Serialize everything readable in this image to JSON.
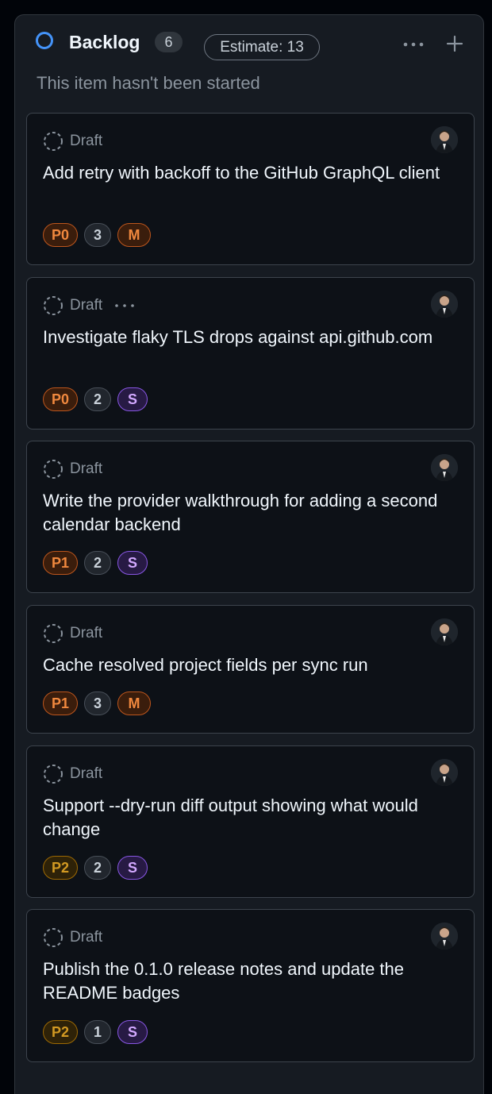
{
  "column": {
    "title": "Backlog",
    "count": "6",
    "estimate": "Estimate: 13",
    "description": "This item hasn't been started",
    "status_color": "#4493f8",
    "icons": {
      "more": "ellipsis-icon",
      "add": "plus-icon"
    }
  },
  "cards": [
    {
      "type": "Draft",
      "title": "Add retry with backoff to the GitHub GraphQL client",
      "priority": "P0",
      "estimate": "3",
      "size": "M",
      "has_menu": false
    },
    {
      "type": "Draft",
      "title": "Investigate flaky TLS drops against api.github.com",
      "priority": "P0",
      "estimate": "2",
      "size": "S",
      "has_menu": true
    },
    {
      "type": "Draft",
      "title": "Write the provider walkthrough for adding a second calendar backend",
      "priority": "P1",
      "estimate": "2",
      "size": "S",
      "has_menu": false
    },
    {
      "type": "Draft",
      "title": "Cache resolved project fields per sync run",
      "priority": "P1",
      "estimate": "3",
      "size": "M",
      "has_menu": false
    },
    {
      "type": "Draft",
      "title": "Support --dry-run diff output showing what would change",
      "priority": "P2",
      "estimate": "2",
      "size": "S",
      "has_menu": false
    },
    {
      "type": "Draft",
      "title": "Publish the 0.1.0 release notes and update the README badges",
      "priority": "P2",
      "estimate": "1",
      "size": "S",
      "has_menu": false
    }
  ]
}
